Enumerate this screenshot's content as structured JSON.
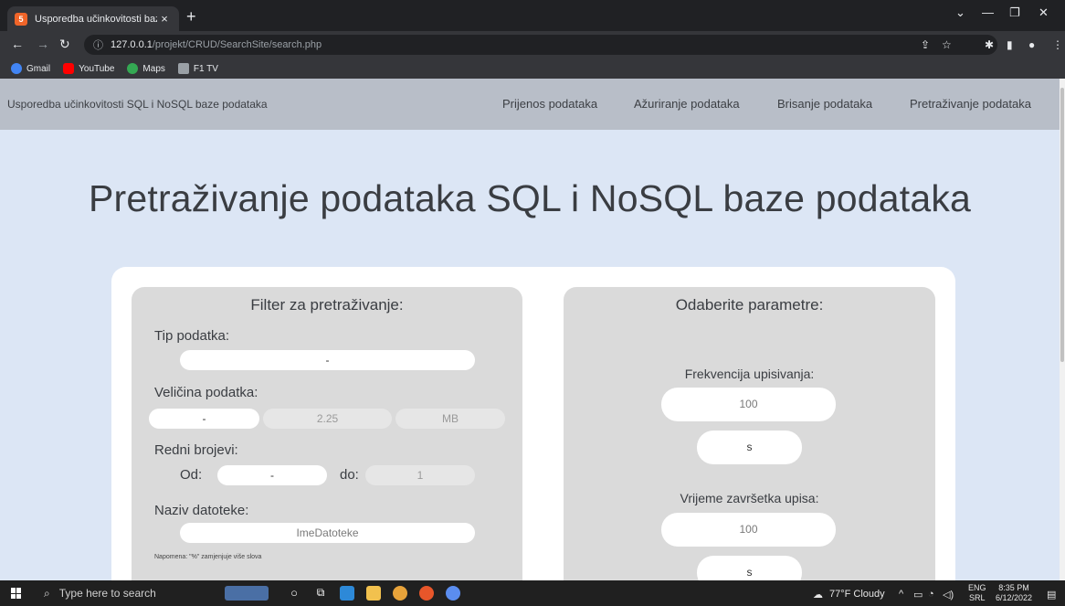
{
  "browser": {
    "tab_title": "Usporedba učinkovitosti baza",
    "tab_close": "×",
    "new_tab": "+",
    "url_host": "127.0.0.1",
    "url_path": "/projekt/CRUD/SearchSite/search.php",
    "bookmarks": [
      {
        "label": "Gmail",
        "color": "#4285f4"
      },
      {
        "label": "YouTube",
        "color": "#ff0000"
      },
      {
        "label": "Maps",
        "color": "#34a853"
      },
      {
        "label": "F1 TV",
        "color": "#9aa0a6"
      }
    ]
  },
  "navbar": {
    "brand": "Usporedba učinkovitosti SQL i NoSQL baze podataka",
    "links": [
      "Prijenos podataka",
      "Ažuriranje podataka",
      "Brisanje podataka",
      "Pretraživanje podataka"
    ]
  },
  "page": {
    "title": "Pretraživanje podataka SQL i NoSQL baze podataka"
  },
  "filter": {
    "heading": "Filter za pretraživanje:",
    "type_label": "Tip podatka:",
    "type_value": "-",
    "size_label": "Veličina podatka:",
    "size_operator": "-",
    "size_value": "2.25",
    "size_unit": "MB",
    "ordinal_label": "Redni brojevi:",
    "from_label": "Od:",
    "from_value": "-",
    "to_label": "do:",
    "to_value": "1",
    "filename_label": "Naziv datoteke:",
    "filename_placeholder": "ImeDatoteke",
    "note": "Napomena: \"%\" zamjenjuje više slova"
  },
  "params": {
    "heading": "Odaberite parametre:",
    "frequency_label": "Frekvencija upisivanja:",
    "frequency_value": "100",
    "frequency_unit": "s",
    "end_label": "Vrijeme završetka upisa:",
    "end_value": "100",
    "end_unit": "s"
  },
  "taskbar": {
    "search_placeholder": "Type here to search",
    "weather": "77°F Cloudy",
    "lang_top": "ENG",
    "lang_bottom": "SRL",
    "time": "8:35 PM",
    "date": "6/12/2022"
  }
}
